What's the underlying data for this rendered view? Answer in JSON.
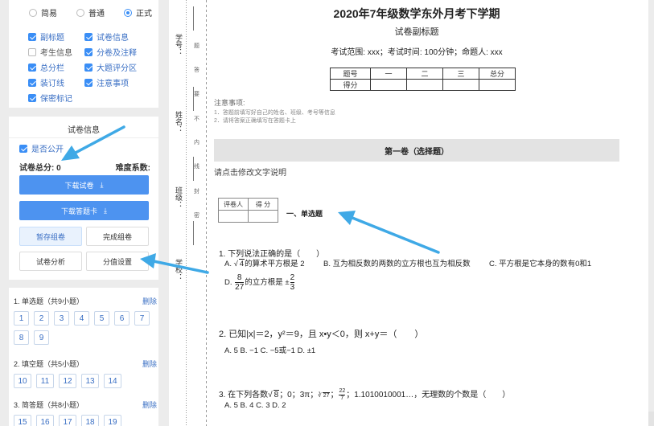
{
  "settings": {
    "radios": [
      {
        "label": "简易",
        "checked": false
      },
      {
        "label": "普通",
        "checked": false
      },
      {
        "label": "正式",
        "checked": true
      }
    ],
    "checkboxes": [
      {
        "label": "副标题",
        "checked": true
      },
      {
        "label": "试卷信息",
        "checked": true
      },
      {
        "label": "考生信息",
        "checked": false
      },
      {
        "label": "分卷及注释",
        "checked": true
      },
      {
        "label": "总分栏",
        "checked": true
      },
      {
        "label": "大题评分区",
        "checked": true
      },
      {
        "label": "装订线",
        "checked": true
      },
      {
        "label": "注意事项",
        "checked": true
      },
      {
        "label": "保密标记",
        "checked": true
      }
    ]
  },
  "paper_info": {
    "title": "试卷信息",
    "public_label": "是否公开",
    "total_score_label": "试卷总分: 0",
    "difficulty_label": "难度系数:",
    "download_paper": "下载试卷",
    "download_answer": "下载答题卡",
    "save_draft": "暂存组卷",
    "finish": "完成组卷",
    "analysis": "试卷分析",
    "score_setting": "分值设置"
  },
  "question_nav": [
    {
      "title": "1. 单选题（共9小题）",
      "delete": "删除",
      "nums": [
        "1",
        "2",
        "3",
        "4",
        "5",
        "6",
        "7",
        "8",
        "9"
      ]
    },
    {
      "title": "2. 填空题（共5小题）",
      "delete": "删除",
      "nums": [
        "10",
        "11",
        "12",
        "13",
        "14"
      ]
    },
    {
      "title": "3. 简答题（共8小题）",
      "delete": "删除",
      "nums": [
        "15",
        "16",
        "17",
        "18",
        "19"
      ]
    }
  ],
  "binding": {
    "student_id": "学号：",
    "name": "姓名：",
    "class": "班级：",
    "school": "学校：",
    "chars": [
      "题",
      "答",
      "要",
      "不",
      "内",
      "线",
      "封",
      "密"
    ]
  },
  "exam": {
    "title": "2020年7年级数学东外月考下学期",
    "subtitle": "试卷副标题",
    "info": "考试范围: xxx；考试时间: 100分钟；命题人: xxx",
    "score_table": {
      "row1": [
        "题号",
        "一",
        "二",
        "三",
        "总分"
      ],
      "row2": [
        "得分",
        "",
        "",
        "",
        ""
      ]
    },
    "notice_title": "注意事项:",
    "notice_lines": [
      "1．答题前填写好自己的姓名、班级、考号等信息",
      "2．请将答案正确填写在答题卡上"
    ],
    "part_title": "第一卷（选择题）",
    "edit_desc": "请点击修改文字说明",
    "grader_headers": [
      "评卷人",
      "得 分"
    ],
    "section_title": "一、单选题",
    "q1": {
      "stem": "1.  下列说法正确的是（　　）",
      "a_label": "A.",
      "a_radicand": "4",
      "a_text": "的算术平方根是 2",
      "b": "B.  互为相反数的两数的立方根也互为相反数",
      "c": "C.  平方根是它本身的数有0和1",
      "d_label": "D.",
      "d_num": "8",
      "d_den": "27",
      "d_text": "的立方根是 ±",
      "d_num2": "2",
      "d_den2": "3"
    },
    "q2": {
      "stem": "2.  已知|x|＝2，y²＝9，且 x•y＜0，则 x+y＝（　　）",
      "options": "A. 5  B. −1  C. −5或−1  D. ±1"
    },
    "q3": {
      "num": "3.",
      "stem_a": "在下列各数",
      "sqrt_val": "8",
      "stem_b": "；0；3π；",
      "cbrt_val": "27",
      "stem_c": "；",
      "frac_num": "22",
      "frac_den": "7",
      "stem_d": "；1.1010010001…，无理数的个数是（　　）",
      "options": "A. 5  B. 4  C. 3  D. 2"
    }
  },
  "colors": {
    "accent": "#4d93f0",
    "arrow": "#3fa9e6"
  }
}
